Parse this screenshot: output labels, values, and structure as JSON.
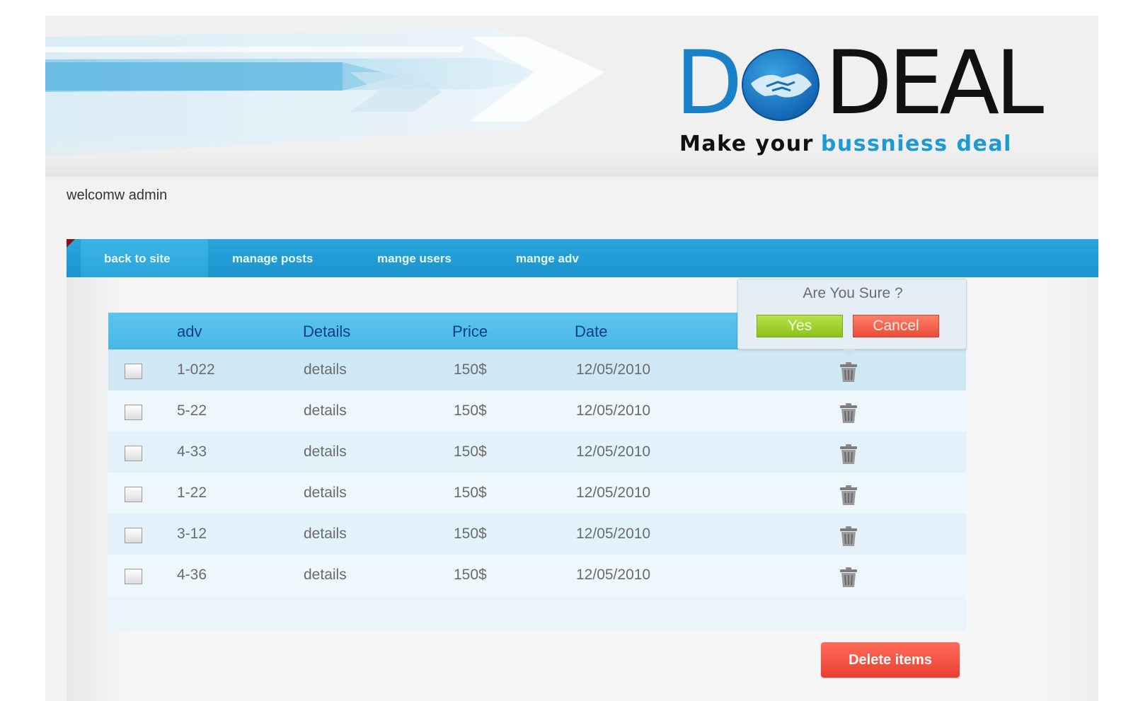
{
  "brand": {
    "logo_d": "D",
    "logo_rest": "DEAL",
    "tagline_part1": "Make your",
    "tagline_part2": "bussniess deal",
    "colors": {
      "blue": "#1a80c8",
      "dark": "#111111",
      "tagline_blue": "#1d9ad6"
    }
  },
  "welcome_text": "welcomw admin",
  "nav": {
    "items": [
      {
        "label": "back to site",
        "active": true
      },
      {
        "label": "manage posts",
        "active": false
      },
      {
        "label": "mange users",
        "active": false
      },
      {
        "label": "mange adv",
        "active": false
      }
    ],
    "color": "#1b93cd"
  },
  "table": {
    "headers": {
      "adv": "adv",
      "details": "Details",
      "price": "Price",
      "date": "Date"
    },
    "rows": [
      {
        "adv": "1-022",
        "details": "details",
        "price": "150$",
        "date": "12/05/2010",
        "checked": false,
        "highlighted": true
      },
      {
        "adv": "5-22",
        "details": "details",
        "price": "150$",
        "date": "12/05/2010",
        "checked": false,
        "highlighted": false
      },
      {
        "adv": "4-33",
        "details": "details",
        "price": "150$",
        "date": "12/05/2010",
        "checked": false,
        "highlighted": false
      },
      {
        "adv": "1-22",
        "details": "details",
        "price": "150$",
        "date": "12/05/2010",
        "checked": false,
        "highlighted": false
      },
      {
        "adv": "3-12",
        "details": "details",
        "price": "150$",
        "date": "12/05/2010",
        "checked": false,
        "highlighted": false
      },
      {
        "adv": "4-36",
        "details": "details",
        "price": "150$",
        "date": "12/05/2010",
        "checked": false,
        "highlighted": false
      }
    ],
    "row_icon": "trash-icon"
  },
  "confirm_popup": {
    "title": "Are You Sure ?",
    "yes_label": "Yes",
    "cancel_label": "Cancel",
    "colors": {
      "yes": "#8cc21a",
      "cancel": "#ea4b38"
    }
  },
  "delete_button_label": "Delete items"
}
